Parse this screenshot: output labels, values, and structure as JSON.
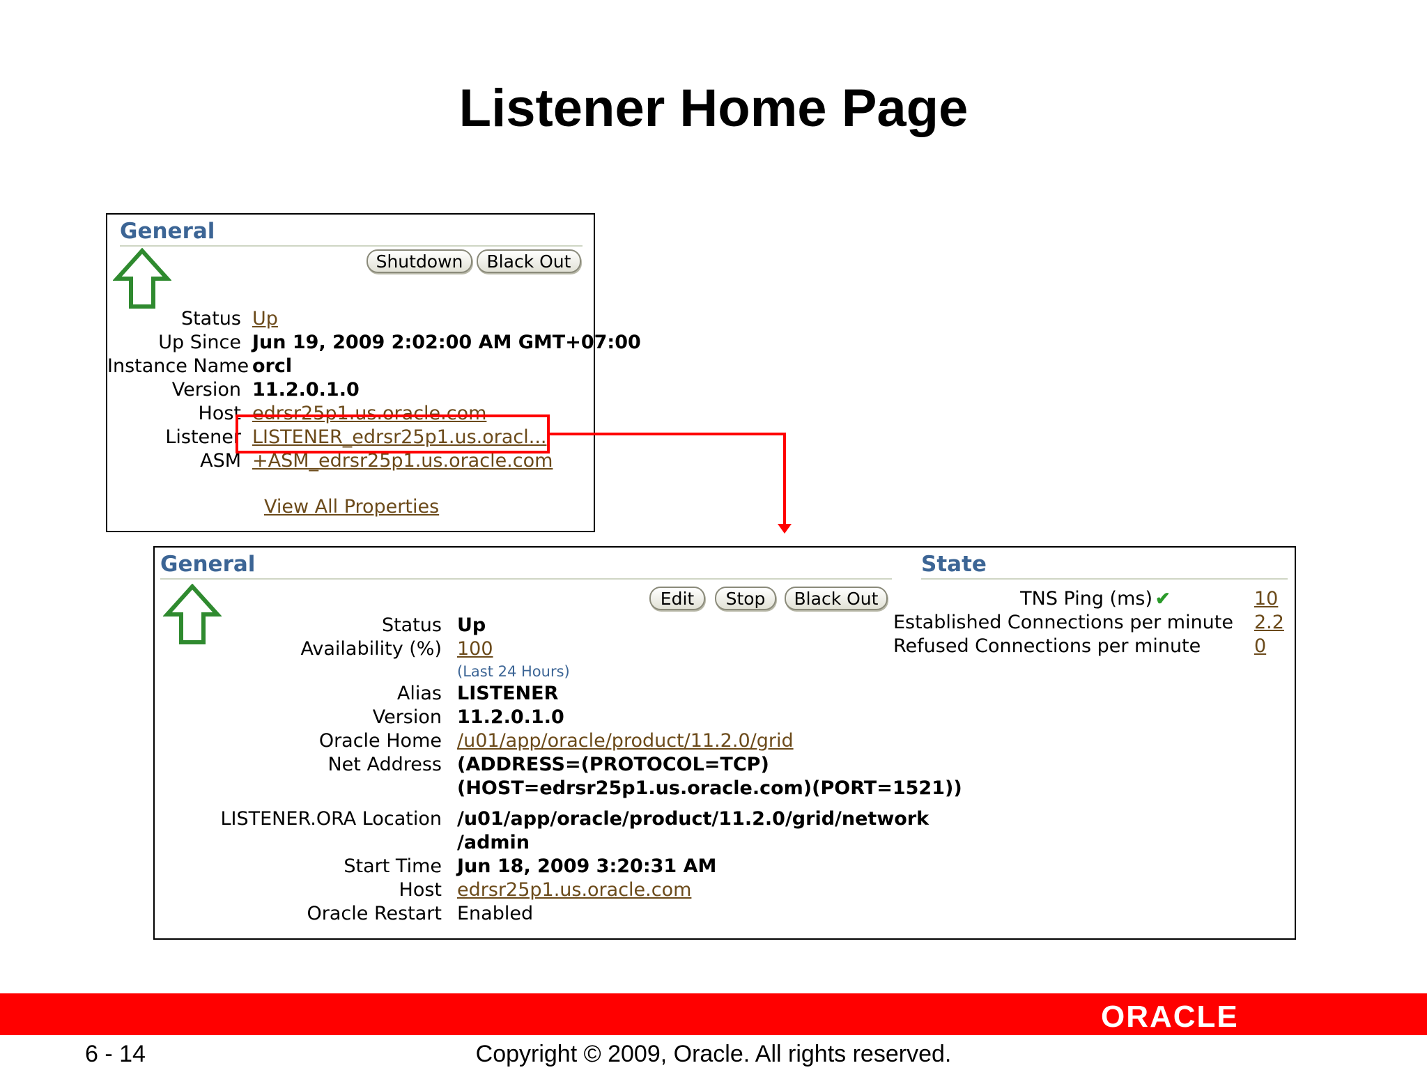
{
  "slide": {
    "title": "Listener Home Page",
    "page_number": "6 - 14",
    "copyright": "Copyright © 2009, Oracle. All rights reserved.",
    "brand": "ORACLE"
  },
  "db_panel": {
    "section_title": "General",
    "buttons": {
      "shutdown": "Shutdown",
      "black_out": "Black Out"
    },
    "rows": {
      "status_label": "Status",
      "status_value": "Up",
      "up_since_label": "Up Since",
      "up_since_value": "Jun 19, 2009 2:02:00 AM GMT+07:00",
      "instance_label": "Instance Name",
      "instance_value": "orcl",
      "version_label": "Version",
      "version_value": "11.2.0.1.0",
      "host_label": "Host",
      "host_value": "edrsr25p1.us.oracle.com",
      "listener_label": "Listener",
      "listener_value": "LISTENER_edrsr25p1.us.oracl...",
      "asm_label": "ASM",
      "asm_value": "+ASM_edrsr25p1.us.oracle.com"
    },
    "view_all": "View All Properties"
  },
  "listener_panel": {
    "section_title": "General",
    "buttons": {
      "edit": "Edit",
      "stop": "Stop",
      "black_out": "Black Out"
    },
    "rows": {
      "status_label": "Status",
      "status_value": "Up",
      "availability_label": "Availability (%)",
      "availability_value": "100",
      "availability_note": "(Last 24 Hours)",
      "alias_label": "Alias",
      "alias_value": "LISTENER",
      "version_label": "Version",
      "version_value": "11.2.0.1.0",
      "oracle_home_label": "Oracle Home",
      "oracle_home_value": "/u01/app/oracle/product/11.2.0/grid",
      "net_address_label": "Net Address",
      "net_address_line1": "(ADDRESS=(PROTOCOL=TCP)",
      "net_address_line2": "(HOST=edrsr25p1.us.oracle.com)(PORT=1521))",
      "ora_location_label": "LISTENER.ORA Location",
      "ora_location_line1": "/u01/app/oracle/product/11.2.0/grid/network",
      "ora_location_line2": "/admin",
      "start_time_label": "Start Time",
      "start_time_value": "Jun 18, 2009 3:20:31 AM",
      "host_label": "Host",
      "host_value": "edrsr25p1.us.oracle.com",
      "restart_label": "Oracle Restart",
      "restart_value": "Enabled"
    }
  },
  "state_panel": {
    "section_title": "State",
    "tns_ping_label": "TNS Ping (ms)",
    "tns_ping_value": "10",
    "established_label": "Established Connections per minute",
    "established_value": "2.2",
    "refused_label": "Refused Connections per minute",
    "refused_value": "0"
  },
  "colors": {
    "accent_red": "#ff0000",
    "heading_blue": "#3c6595",
    "link_brown": "#6b4a1a",
    "status_green": "#2f8a2f"
  },
  "icons": {
    "status_up": "up-arrow-icon",
    "ping_ok": "checkmark-icon"
  }
}
